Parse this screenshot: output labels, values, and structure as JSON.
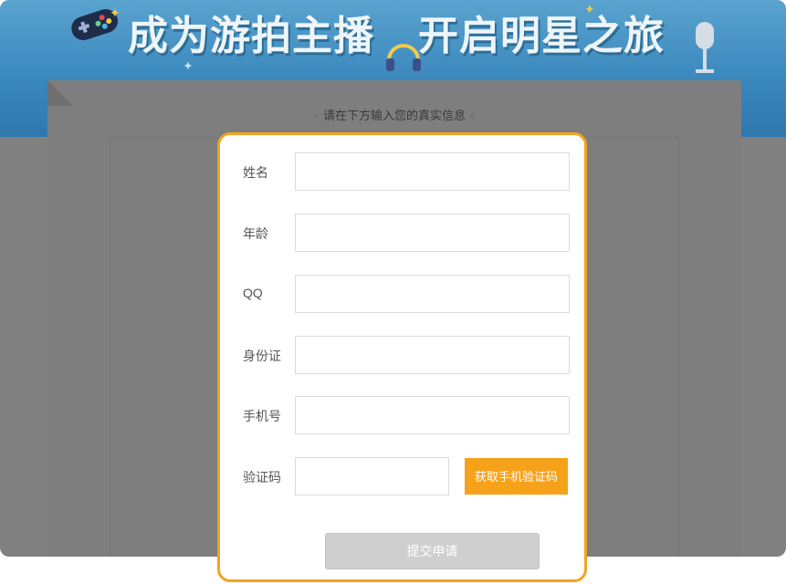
{
  "banner": {
    "title_part1": "成为游拍主播",
    "title_part2": "开启明星之旅"
  },
  "paper": {
    "header": "请在下方输入您的真实信息",
    "header_mark": "⁘"
  },
  "form": {
    "fields": [
      {
        "label": "姓名",
        "value": "",
        "placeholder": ""
      },
      {
        "label": "年龄",
        "value": "",
        "placeholder": ""
      },
      {
        "label": "QQ",
        "value": "",
        "placeholder": ""
      },
      {
        "label": "身份证",
        "value": "",
        "placeholder": ""
      },
      {
        "label": "手机号",
        "value": "",
        "placeholder": ""
      },
      {
        "label": "验证码",
        "value": "",
        "placeholder": ""
      }
    ],
    "sms_button_label": "获取手机验证码",
    "submit_label": "提交申请"
  },
  "icons": [
    "gamepad-icon",
    "headphone-icon",
    "microphone-icon",
    "star-icon"
  ],
  "colors": {
    "accent": "#f6a11a",
    "banner_blue": "#3a87bd",
    "overlay": "#808080",
    "submit_disabled": "#cfcfcf"
  }
}
